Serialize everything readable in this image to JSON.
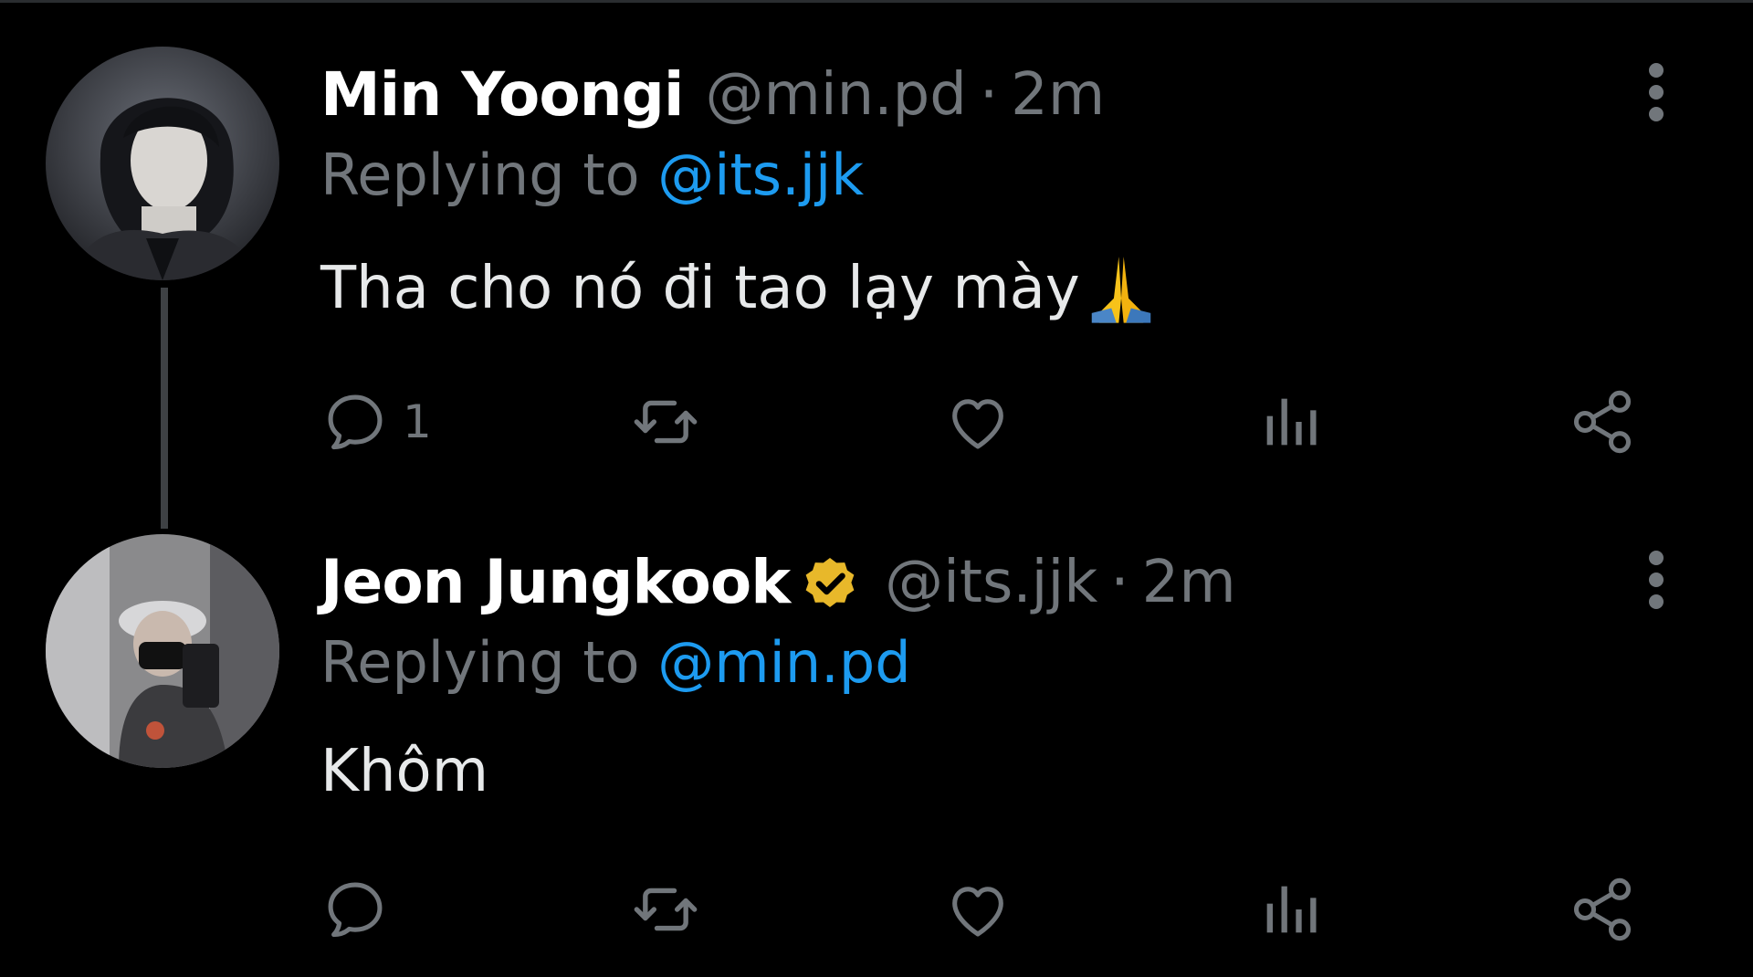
{
  "tweets": [
    {
      "name": "Min Yoongi",
      "handle": "@min.pd",
      "separator": "·",
      "time": "2m",
      "replying_prefix": "Replying to",
      "replying_to": "@its.jjk",
      "text": "Tha cho nó đi tao lạy mày",
      "emoji": "🙏",
      "verified": false,
      "reply_count": "1"
    },
    {
      "name": "Jeon Jungkook",
      "handle": "@its.jjk",
      "separator": "·",
      "time": "2m",
      "replying_prefix": "Replying to",
      "replying_to": "@min.pd",
      "text": "Khôm",
      "verified": true,
      "reply_count": ""
    }
  ],
  "colors": {
    "background": "#000000",
    "name": "#ffffff",
    "secondary": "#71767b",
    "mention": "#1d9bf0",
    "verified_badge": "#e8b82a",
    "thread_line": "#3e4144"
  },
  "icons": [
    "reply-icon",
    "retweet-icon",
    "like-icon",
    "views-icon",
    "share-icon",
    "more-icon",
    "verified-badge-icon"
  ]
}
